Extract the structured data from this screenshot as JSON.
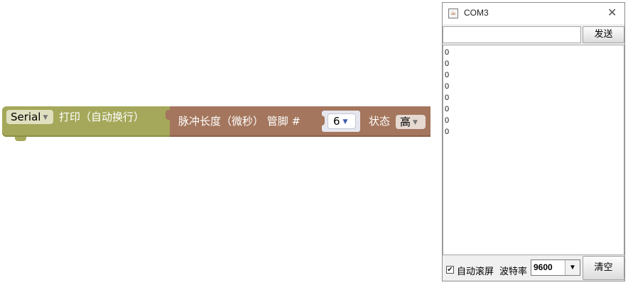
{
  "blocks": {
    "serial_dropdown": "Serial",
    "serial_print": "打印（自动换行）",
    "pulse_label": "脉冲长度（微秒） 管脚 #",
    "pin_value": "6",
    "state_label": "状态",
    "state_value": "高"
  },
  "window": {
    "title": "COM3",
    "send_input_value": "",
    "send_button": "发送",
    "output_lines": [
      "0",
      "0",
      "0",
      "0",
      "0",
      "0",
      "0",
      "0"
    ],
    "autoscroll_label": "自动滚屏",
    "autoscroll_checked": true,
    "baud_label": "波特率",
    "baud_value": "9600",
    "clear_button": "清空"
  },
  "icons": {
    "dropdown_arrow": "triangle-down",
    "window_close": "close-x",
    "app_icon": "java-cup-icon",
    "checkbox_check": "check-mark"
  },
  "colors": {
    "serial_block": "#a5a85a",
    "pulse_block": "#a4765d"
  }
}
